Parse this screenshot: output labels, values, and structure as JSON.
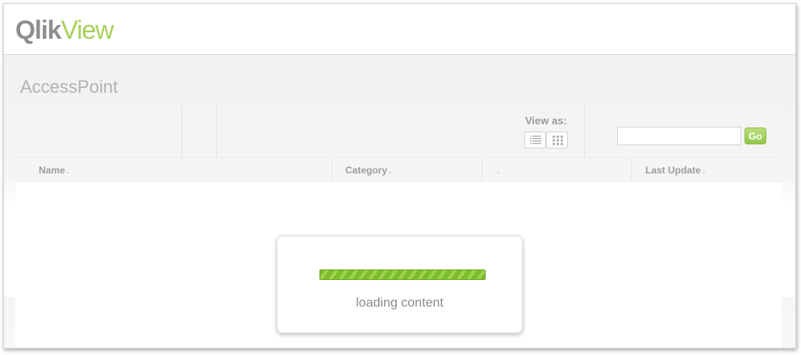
{
  "logo": {
    "part1": "Qlik",
    "part2": "View"
  },
  "page": {
    "title": "AccessPoint"
  },
  "toolbar": {
    "view_as_label": "View as:",
    "view_list_icon": "list-view-icon",
    "view_grid_icon": "grid-view-icon",
    "search": {
      "value": "",
      "placeholder": ""
    },
    "go_label": "Go"
  },
  "table": {
    "columns": [
      {
        "label": "Name",
        "sort": "⌄"
      },
      {
        "label": "Category",
        "sort": "⌄"
      },
      {
        "label": "",
        "sort": "⌄"
      },
      {
        "label": "Last Update",
        "sort": "⌄"
      }
    ],
    "rows": []
  },
  "loading": {
    "text": "loading content",
    "progress": 1.0
  },
  "colors": {
    "brand_green": "#a8d05a",
    "brand_grey": "#8e8e8e",
    "go_button": "#93c64a",
    "progress_green": "#7bbd2a"
  }
}
